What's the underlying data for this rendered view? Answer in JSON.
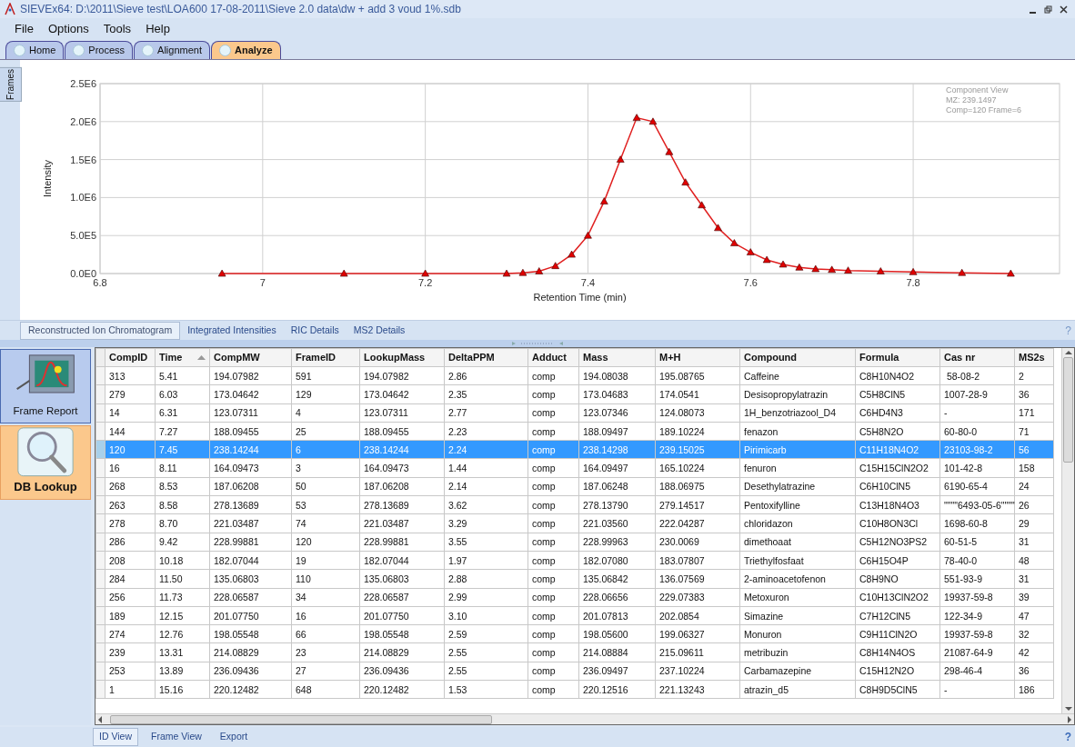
{
  "window": {
    "title": "SIEVEx64: D:\\2011\\Sieve test\\LOA600 17-08-2011\\Sieve 2.0 data\\dw + add 3 voud 1%.sdb"
  },
  "menu": [
    "File",
    "Options",
    "Tools",
    "Help"
  ],
  "tabs": [
    {
      "label": "Home",
      "selected": false
    },
    {
      "label": "Process",
      "selected": false
    },
    {
      "label": "Alignment",
      "selected": false
    },
    {
      "label": "Analyze",
      "selected": true
    }
  ],
  "side_tab": "Frames",
  "chart": {
    "legend": [
      "Component View",
      "MZ: 239.1497",
      "Comp=120 Frame=6"
    ],
    "chart_data": {
      "type": "line",
      "grid": true,
      "marker": "triangle",
      "xlabel": "Retention Time (min)",
      "ylabel": "Intensity",
      "xlim": [
        6.8,
        7.98
      ],
      "ylim": [
        0,
        2500000
      ],
      "xticks": [
        6.8,
        7,
        7.2,
        7.4,
        7.6,
        7.8
      ],
      "yticks": [
        {
          "value": 0,
          "label": "0.0E0"
        },
        {
          "value": 500000,
          "label": "5.0E5"
        },
        {
          "value": 1000000,
          "label": "1.0E6"
        },
        {
          "value": 1500000,
          "label": "1.5E6"
        },
        {
          "value": 2000000,
          "label": "2.0E6"
        },
        {
          "value": 2500000,
          "label": "2.5E6"
        }
      ],
      "x": [
        6.95,
        7.1,
        7.2,
        7.3,
        7.32,
        7.34,
        7.36,
        7.38,
        7.4,
        7.42,
        7.44,
        7.46,
        7.48,
        7.5,
        7.52,
        7.54,
        7.56,
        7.58,
        7.6,
        7.62,
        7.64,
        7.66,
        7.68,
        7.7,
        7.72,
        7.76,
        7.8,
        7.86,
        7.92
      ],
      "values": [
        0,
        0,
        0,
        0,
        10000,
        30000,
        100000,
        250000,
        500000,
        950000,
        1500000,
        2050000,
        2000000,
        1600000,
        1200000,
        900000,
        600000,
        400000,
        280000,
        180000,
        120000,
        80000,
        60000,
        50000,
        40000,
        30000,
        20000,
        10000,
        0
      ]
    }
  },
  "chart_tabs": [
    {
      "label": "Reconstructed Ion Chromatogram",
      "selected": true
    },
    {
      "label": "Integrated Intensities",
      "selected": false
    },
    {
      "label": "RIC Details",
      "selected": false
    },
    {
      "label": "MS2 Details",
      "selected": false
    }
  ],
  "help": "?",
  "side_buttons": [
    {
      "label": "Frame Report",
      "kind": "chart",
      "selected": false
    },
    {
      "label": "DB Lookup",
      "kind": "magnifier",
      "selected": true
    }
  ],
  "table": {
    "columns": [
      "CompID",
      "Time",
      "CompMW",
      "FrameID",
      "LookupMass",
      "DeltaPPM",
      "Adduct",
      "Mass",
      "M+H",
      "Compound",
      "Formula",
      "Cas nr",
      "MS2s"
    ],
    "rows": [
      {
        "selected": false,
        "cells": [
          "313",
          "5.41",
          "194.07982",
          "591",
          "194.07982",
          "2.86",
          "comp",
          "194.08038",
          "195.08765",
          "Caffeine",
          "C8H10N4O2",
          " 58-08-2",
          "2"
        ]
      },
      {
        "selected": false,
        "cells": [
          "279",
          "6.03",
          "173.04642",
          "129",
          "173.04642",
          "2.35",
          "comp",
          "173.04683",
          "174.0541",
          "Desisopropylatrazin",
          "C5H8ClN5",
          "1007-28-9",
          "36"
        ]
      },
      {
        "selected": false,
        "cells": [
          "14",
          "6.31",
          "123.07311",
          "4",
          "123.07311",
          "2.77",
          "comp",
          "123.07346",
          "124.08073",
          "1H_benzotriazool_D4",
          "C6HD4N3",
          "-",
          "171"
        ]
      },
      {
        "selected": false,
        "cells": [
          "144",
          "7.27",
          "188.09455",
          "25",
          "188.09455",
          "2.23",
          "comp",
          "188.09497",
          "189.10224",
          "fenazon",
          "C5H8N2O",
          "60-80-0",
          "71"
        ]
      },
      {
        "selected": true,
        "cells": [
          "120",
          "7.45",
          "238.14244",
          "6",
          "238.14244",
          "2.24",
          "comp",
          "238.14298",
          "239.15025",
          "Pirimicarb",
          "C11H18N4O2",
          "23103-98-2",
          "56"
        ]
      },
      {
        "selected": false,
        "cells": [
          "16",
          "8.11",
          "164.09473",
          "3",
          "164.09473",
          "1.44",
          "comp",
          "164.09497",
          "165.10224",
          "fenuron",
          "C15H15ClN2O2",
          "101-42-8",
          "158"
        ]
      },
      {
        "selected": false,
        "cells": [
          "268",
          "8.53",
          "187.06208",
          "50",
          "187.06208",
          "2.14",
          "comp",
          "187.06248",
          "188.06975",
          "Desethylatrazine",
          "C6H10ClN5",
          "6190-65-4",
          "24"
        ]
      },
      {
        "selected": false,
        "cells": [
          "263",
          "8.58",
          "278.13689",
          "53",
          "278.13689",
          "3.62",
          "comp",
          "278.13790",
          "279.14517",
          "Pentoxifylline",
          "C13H18N4O3",
          "\"\"\"\"6493-05-6\"\"\"\"",
          "26"
        ]
      },
      {
        "selected": false,
        "cells": [
          "278",
          "8.70",
          "221.03487",
          "74",
          "221.03487",
          "3.29",
          "comp",
          "221.03560",
          "222.04287",
          "chloridazon",
          "C10H8ON3Cl",
          "1698-60-8",
          "29"
        ]
      },
      {
        "selected": false,
        "cells": [
          "286",
          "9.42",
          "228.99881",
          "120",
          "228.99881",
          "3.55",
          "comp",
          "228.99963",
          "230.0069",
          "dimethoaat",
          "C5H12NO3PS2",
          "60-51-5",
          "31"
        ]
      },
      {
        "selected": false,
        "cells": [
          "208",
          "10.18",
          "182.07044",
          "19",
          "182.07044",
          "1.97",
          "comp",
          "182.07080",
          "183.07807",
          "Triethylfosfaat",
          "C6H15O4P",
          "78-40-0",
          "48"
        ]
      },
      {
        "selected": false,
        "cells": [
          "284",
          "11.50",
          "135.06803",
          "110",
          "135.06803",
          "2.88",
          "comp",
          "135.06842",
          "136.07569",
          "2-aminoacetofenon",
          "C8H9NO",
          "551-93-9",
          "31"
        ]
      },
      {
        "selected": false,
        "cells": [
          "256",
          "11.73",
          "228.06587",
          "34",
          "228.06587",
          "2.99",
          "comp",
          "228.06656",
          "229.07383",
          "Metoxuron",
          "C10H13ClN2O2",
          "19937-59-8",
          "39"
        ]
      },
      {
        "selected": false,
        "cells": [
          "189",
          "12.15",
          "201.07750",
          "16",
          "201.07750",
          "3.10",
          "comp",
          "201.07813",
          "202.0854",
          "Simazine",
          "C7H12ClN5",
          "122-34-9",
          "47"
        ]
      },
      {
        "selected": false,
        "cells": [
          "274",
          "12.76",
          "198.05548",
          "66",
          "198.05548",
          "2.59",
          "comp",
          "198.05600",
          "199.06327",
          "Monuron",
          "C9H11ClN2O",
          "19937-59-8",
          "32"
        ]
      },
      {
        "selected": false,
        "cells": [
          "239",
          "13.31",
          "214.08829",
          "23",
          "214.08829",
          "2.55",
          "comp",
          "214.08884",
          "215.09611",
          "metribuzin",
          "C8H14N4OS",
          "21087-64-9",
          "42"
        ]
      },
      {
        "selected": false,
        "cells": [
          "253",
          "13.89",
          "236.09436",
          "27",
          "236.09436",
          "2.55",
          "comp",
          "236.09497",
          "237.10224",
          "Carbamazepine",
          "C15H12N2O",
          "298-46-4",
          "36"
        ]
      },
      {
        "selected": false,
        "cells": [
          "1",
          "15.16",
          "220.12482",
          "648",
          "220.12482",
          "1.53",
          "comp",
          "220.12516",
          "221.13243",
          "atrazin_d5",
          "C8H9D5ClN5",
          "-",
          "186"
        ]
      }
    ]
  },
  "bottom_tabs": [
    {
      "label": "ID View",
      "selected": true
    },
    {
      "label": "Frame View",
      "selected": false
    },
    {
      "label": "Export",
      "selected": false
    }
  ]
}
